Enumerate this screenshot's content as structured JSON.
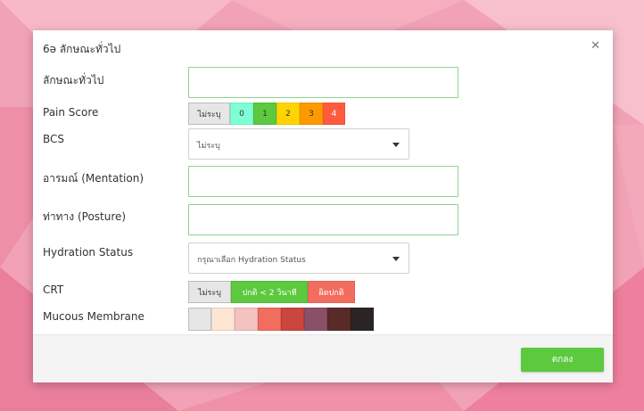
{
  "modal": {
    "title": "6ə ลักษณะทั่วไป",
    "close_icon": "close-icon",
    "fields": {
      "general": {
        "label": "ลักษณะทั่วไป",
        "value": ""
      },
      "pain_score": {
        "label": "Pain Score",
        "options": [
          {
            "label": "ไม่ระบุ",
            "color": "#e6e6e6",
            "selected": true
          },
          {
            "label": "0",
            "color": "#7fffd4"
          },
          {
            "label": "1",
            "color": "#5cc93f"
          },
          {
            "label": "2",
            "color": "#ffd400"
          },
          {
            "label": "3",
            "color": "#ff9900"
          },
          {
            "label": "4",
            "color": "#ff5c3f"
          }
        ]
      },
      "bcs": {
        "label": "BCS",
        "selected": "ไม่ระบุ"
      },
      "mentation": {
        "label": "อารมณ์ (Mentation)",
        "value": ""
      },
      "posture": {
        "label": "ท่าทาง (Posture)",
        "value": ""
      },
      "hydration": {
        "label": "Hydration Status",
        "placeholder": "กรุณาเลือก Hydration Status"
      },
      "crt": {
        "label": "CRT",
        "options": [
          {
            "label": "ไม่ระบุ",
            "color": "#e6e6e6",
            "selected": true
          },
          {
            "label": "ปกติ < 2 วินาที",
            "color": "#5cc93f"
          },
          {
            "label": "ผิดปกติ",
            "color": "#f26d5e"
          }
        ]
      },
      "mucous": {
        "label": "Mucous Membrane",
        "swatches": [
          "#e6e6e6",
          "#fde6d4",
          "#f5c2c2",
          "#f26d5e",
          "#c9453d",
          "#8a5068",
          "#5a2a28",
          "#2a2424"
        ]
      }
    },
    "ok_label": "ตกลง"
  }
}
